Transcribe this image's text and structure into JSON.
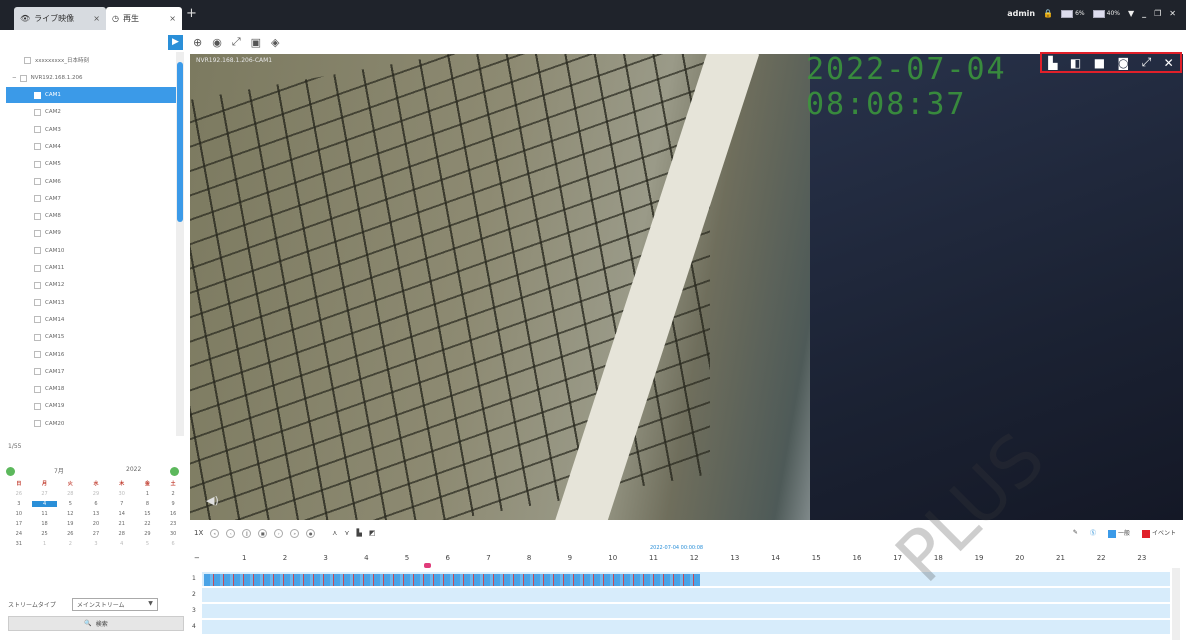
{
  "tabs": [
    {
      "label": "ライブ映像",
      "icon": "eye-icon"
    },
    {
      "label": "再生",
      "icon": "clock-icon"
    }
  ],
  "header": {
    "user": "admin",
    "cpu": "6%",
    "mem": "40%"
  },
  "tree": {
    "root_label": "NVR192.168.1.206",
    "top_label": "xxxxxxxxx_日本時刻",
    "cams": [
      "CAM1",
      "CAM2",
      "CAM3",
      "CAM4",
      "CAM5",
      "CAM6",
      "CAM7",
      "CAM8",
      "CAM9",
      "CAM10",
      "CAM11",
      "CAM12",
      "CAM13",
      "CAM14",
      "CAM15",
      "CAM16",
      "CAM17",
      "CAM18",
      "CAM19",
      "CAM20"
    ],
    "selected_index": 0,
    "page": "1/55"
  },
  "calendar": {
    "month": "7月",
    "year": "2022",
    "weekdays": [
      "日",
      "月",
      "火",
      "水",
      "木",
      "金",
      "土"
    ],
    "days": [
      [
        "26",
        "27",
        "28",
        "29",
        "30",
        "1",
        "2"
      ],
      [
        "3",
        "4",
        "5",
        "6",
        "7",
        "8",
        "9"
      ],
      [
        "10",
        "11",
        "12",
        "13",
        "14",
        "15",
        "16"
      ],
      [
        "17",
        "18",
        "19",
        "20",
        "21",
        "22",
        "23"
      ],
      [
        "24",
        "25",
        "26",
        "27",
        "28",
        "29",
        "30"
      ],
      [
        "31",
        "1",
        "2",
        "3",
        "4",
        "5",
        "6"
      ]
    ],
    "today": "4"
  },
  "stream": {
    "label": "ストリームタイプ",
    "value": "メインストリーム"
  },
  "search_label": "検索",
  "video": {
    "camera": "NVR192.168.1.206-CAM1",
    "timestamp": "2022-07-04 08:08:37"
  },
  "controls": {
    "speed": "1X"
  },
  "legend": {
    "normal": "一般",
    "event": "イベント",
    "normal_color": "#3b9ae8",
    "event_color": "#e0202a"
  },
  "timeline": {
    "date": "2022-07-04 00:00:08",
    "hours": [
      "1",
      "2",
      "3",
      "4",
      "5",
      "6",
      "7",
      "8",
      "9",
      "10",
      "11",
      "12",
      "13",
      "14",
      "15",
      "16",
      "17",
      "18",
      "19",
      "20",
      "21",
      "22",
      "23"
    ],
    "tracks": [
      "1",
      "2",
      "3",
      "4"
    ]
  },
  "watermark": "PLUS"
}
